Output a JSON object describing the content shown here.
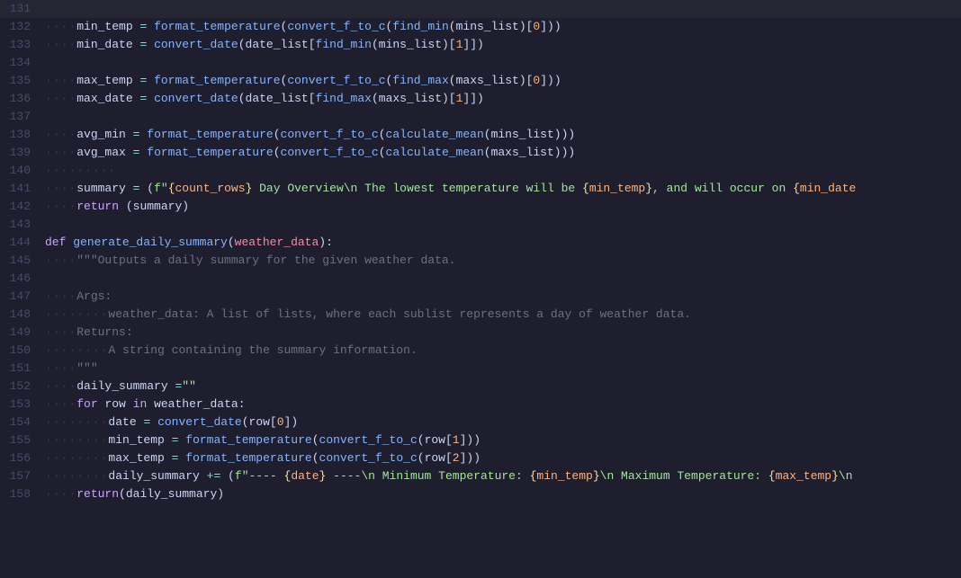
{
  "lines": [
    {
      "num": 131,
      "content": "",
      "indent": 1
    },
    {
      "num": 132,
      "code_html": "<span class='dots'>····</span><span class='var'>min_temp</span> <span class='op'>=</span> <span class='fn'>format_temperature</span><span class='punc'>(</span><span class='fn'>convert_f_to_c</span><span class='punc'>(</span><span class='fn'>find_min</span><span class='punc'>(</span><span class='var'>mins_list</span><span class='punc'>)[</span><span class='num'>0</span><span class='punc'>]))</span>"
    },
    {
      "num": 133,
      "code_html": "<span class='dots'>····</span><span class='var'>min_date</span> <span class='op'>=</span> <span class='fn'>convert_date</span><span class='punc'>(</span><span class='var'>date_list</span><span class='punc'>[</span><span class='fn'>find_min</span><span class='punc'>(</span><span class='var'>mins_list</span><span class='punc'>)[</span><span class='num'>1</span><span class='punc'>]])</span>"
    },
    {
      "num": 134,
      "code_html": ""
    },
    {
      "num": 135,
      "code_html": "<span class='dots'>····</span><span class='var'>max_temp</span> <span class='op'>=</span> <span class='fn'>format_temperature</span><span class='punc'>(</span><span class='fn'>convert_f_to_c</span><span class='punc'>(</span><span class='fn'>find_max</span><span class='punc'>(</span><span class='var'>maxs_list</span><span class='punc'>)[</span><span class='num'>0</span><span class='punc'>]))</span>"
    },
    {
      "num": 136,
      "code_html": "<span class='dots'>····</span><span class='var'>max_date</span> <span class='op'>=</span> <span class='fn'>convert_date</span><span class='punc'>(</span><span class='var'>date_list</span><span class='punc'>[</span><span class='fn'>find_max</span><span class='punc'>(</span><span class='var'>maxs_list</span><span class='punc'>)[</span><span class='num'>1</span><span class='punc'>]])</span>"
    },
    {
      "num": 137,
      "code_html": ""
    },
    {
      "num": 138,
      "code_html": "<span class='dots'>····</span><span class='var'>avg_min</span> <span class='op'>=</span> <span class='fn'>format_temperature</span><span class='punc'>(</span><span class='fn'>convert_f_to_c</span><span class='punc'>(</span><span class='fn'>calculate_mean</span><span class='punc'>(</span><span class='var'>mins_list</span><span class='punc'>)))</span>"
    },
    {
      "num": 139,
      "code_html": "<span class='dots'>····</span><span class='var'>avg_max</span> <span class='op'>=</span> <span class='fn'>format_temperature</span><span class='punc'>(</span><span class='fn'>convert_f_to_c</span><span class='punc'>(</span><span class='fn'>calculate_mean</span><span class='punc'>(</span><span class='var'>maxs_list</span><span class='punc'>)))</span>"
    },
    {
      "num": 140,
      "code_html": "<span class='dots'>····</span><span class='dots'>·····</span>"
    },
    {
      "num": 141,
      "code_html": "<span class='dots'>····</span><span class='var'>summary</span> <span class='op'>=</span> <span class='punc'>(</span><span class='fstr'>f&quot;<span class='bracket'>{</span><span class='fstr-brace'>count_rows</span><span class='bracket'>}</span> Day Overview\\n  The lowest temperature will be <span class='bracket'>{</span><span class='fstr-brace'>min_temp</span><span class='bracket'>}</span>, and will occur on <span class='bracket'>{</span><span class='fstr-brace'>min_date</span></span>"
    },
    {
      "num": 142,
      "code_html": "<span class='dots'>····</span><span class='kw'>return</span> <span class='punc'>(</span><span class='var'>summary</span><span class='punc'>)</span>"
    },
    {
      "num": 143,
      "code_html": ""
    },
    {
      "num": 144,
      "code_html": "<span class='kw'>def</span> <span class='fn'>generate_daily_summary</span><span class='punc'>(</span><span class='param'>weather_data</span><span class='punc'>):</span>"
    },
    {
      "num": 145,
      "code_html": "<span class='dots'>····</span><span class='docstr'>&quot;&quot;&quot;Outputs a daily summary for the given weather data.</span>"
    },
    {
      "num": 146,
      "code_html": ""
    },
    {
      "num": 147,
      "code_html": "<span class='dots'>····</span><span class='docstr'>Args:</span>"
    },
    {
      "num": 148,
      "code_html": "<span class='dots'>········</span><span class='docstr'>weather_data: A list of lists, where each sublist represents a day of weather data.</span>"
    },
    {
      "num": 149,
      "code_html": "<span class='dots'>····</span><span class='docstr'>Returns:</span>"
    },
    {
      "num": 150,
      "code_html": "<span class='dots'>····</span><span class='dots'>····</span><span class='docstr'>A string containing the summary information.</span>"
    },
    {
      "num": 151,
      "code_html": "<span class='dots'>····</span><span class='docstr'>&quot;&quot;&quot;</span>"
    },
    {
      "num": 152,
      "code_html": "<span class='dots'>····</span><span class='var'>daily_summary</span> <span class='op'>=</span><span class='str'>&quot;&quot;</span>"
    },
    {
      "num": 153,
      "code_html": "<span class='dots'>····</span><span class='kw'>for</span> <span class='var'>row</span> <span class='kw'>in</span> <span class='var'>weather_data</span><span class='punc'>:</span>"
    },
    {
      "num": 154,
      "code_html": "<span class='dots'>········</span><span class='var'>date</span> <span class='op'>=</span> <span class='fn'>convert_date</span><span class='punc'>(</span><span class='var'>row</span><span class='punc'>[</span><span class='num'>0</span><span class='punc'>])</span>"
    },
    {
      "num": 155,
      "code_html": "<span class='dots'>········</span><span class='var'>min_temp</span> <span class='op'>=</span> <span class='fn'>format_temperature</span><span class='punc'>(</span><span class='fn'>convert_f_to_c</span><span class='punc'>(</span><span class='var'>row</span><span class='punc'>[</span><span class='num'>1</span><span class='punc'>]))</span>"
    },
    {
      "num": 156,
      "code_html": "<span class='dots'>········</span><span class='var'>max_temp</span> <span class='op'>=</span> <span class='fn'>format_temperature</span><span class='punc'>(</span><span class='fn'>convert_f_to_c</span><span class='punc'>(</span><span class='var'>row</span><span class='punc'>[</span><span class='num'>2</span><span class='punc'>]))</span>"
    },
    {
      "num": 157,
      "code_html": "<span class='dots'>········</span><span class='var'>daily_summary</span> <span class='op'>+=</span> <span class='punc'>(</span><span class='fstr'>f&quot;---- <span class='bracket'>{</span><span class='fstr-brace'>date</span><span class='bracket'>}</span> ----\\n  Minimum Temperature: <span class='bracket'>{</span><span class='fstr-brace'>min_temp</span><span class='bracket'>}</span>\\n  Maximum Temperature: <span class='bracket'>{</span><span class='fstr-brace'>max_temp</span><span class='bracket'>}</span>\\n</span>"
    },
    {
      "num": 158,
      "code_html": "<span class='dots'>····</span><span class='kw'>return</span><span class='punc'>(</span><span class='var'>daily_summary</span><span class='punc'>)</span>"
    }
  ]
}
